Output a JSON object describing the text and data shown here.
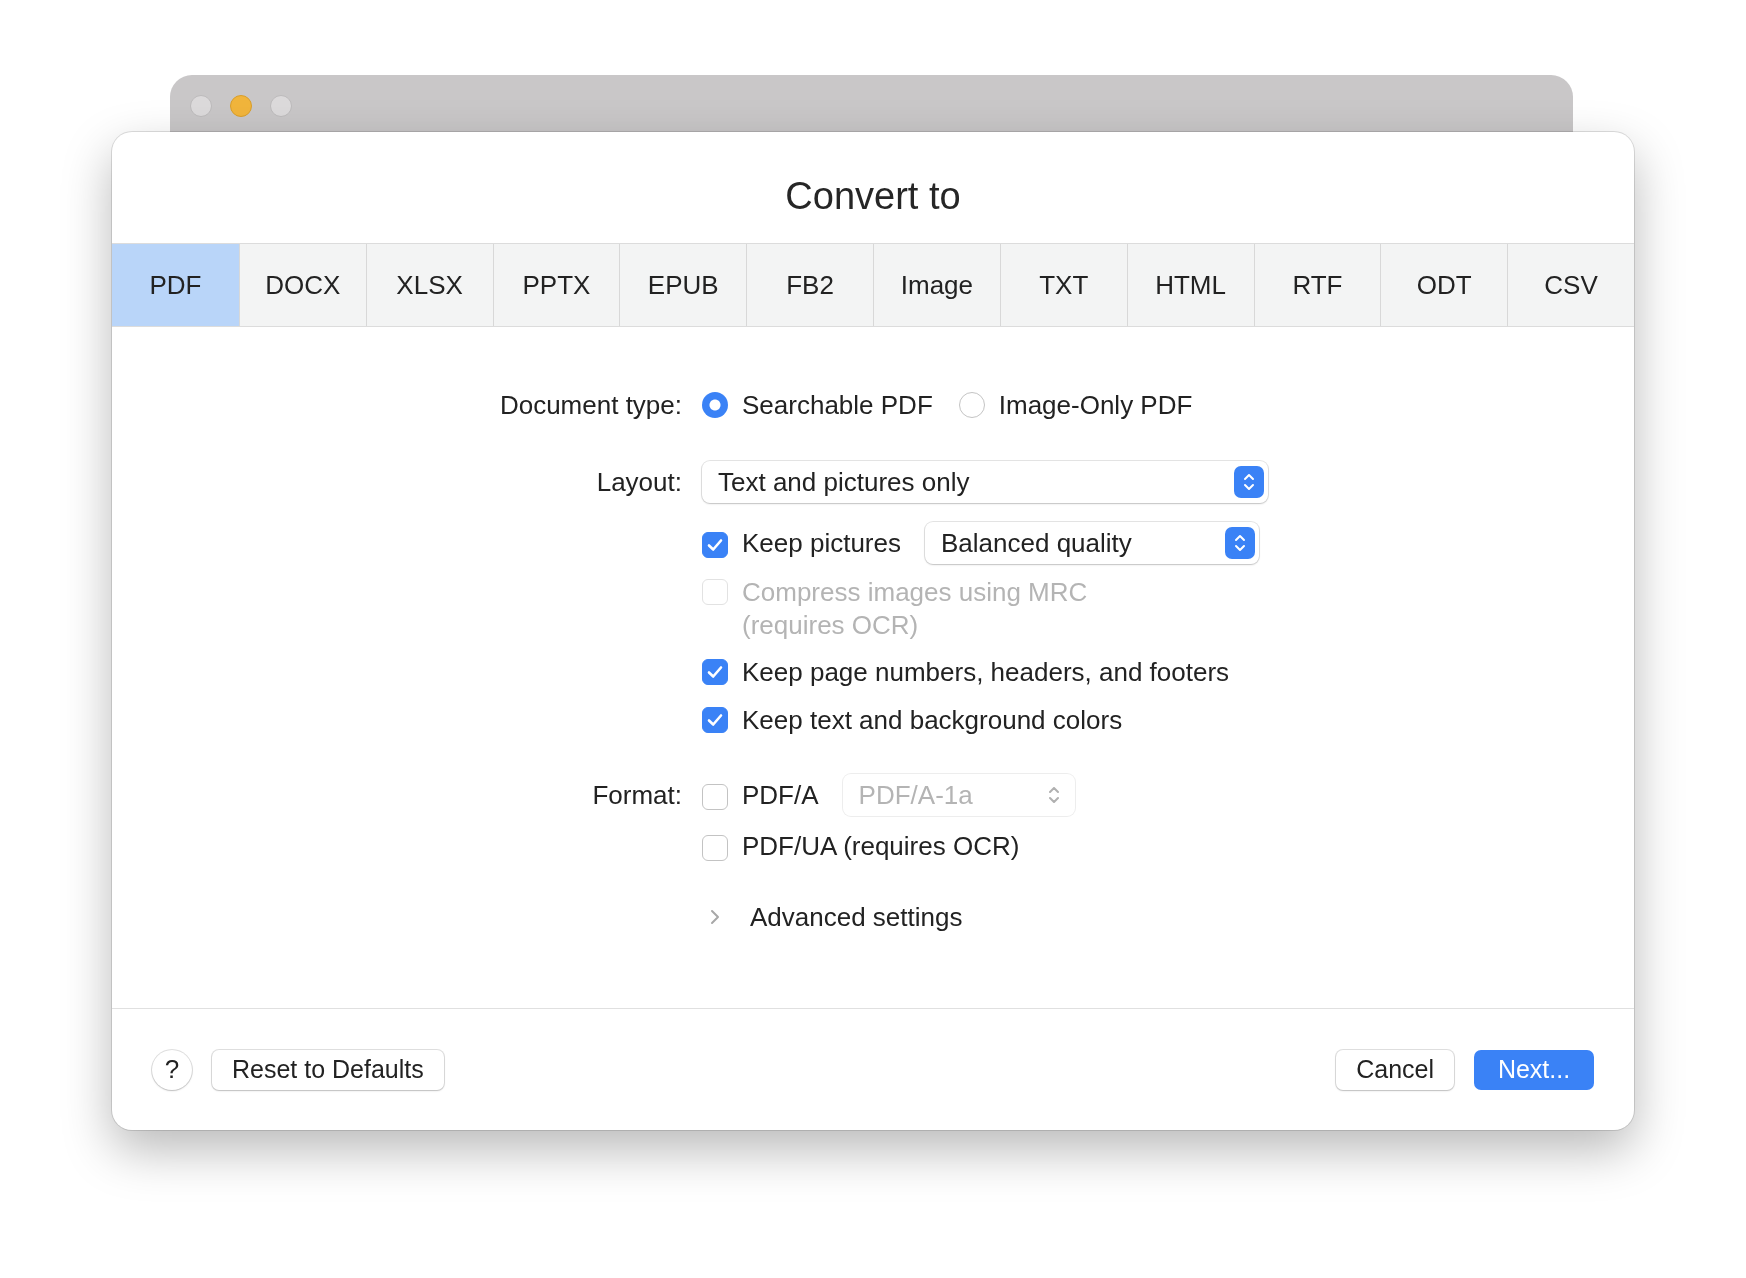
{
  "dialog": {
    "title": "Convert to"
  },
  "tabs": [
    {
      "label": "PDF",
      "selected": true
    },
    {
      "label": "DOCX",
      "selected": false
    },
    {
      "label": "XLSX",
      "selected": false
    },
    {
      "label": "PPTX",
      "selected": false
    },
    {
      "label": "EPUB",
      "selected": false
    },
    {
      "label": "FB2",
      "selected": false
    },
    {
      "label": "Image",
      "selected": false
    },
    {
      "label": "TXT",
      "selected": false
    },
    {
      "label": "HTML",
      "selected": false
    },
    {
      "label": "RTF",
      "selected": false
    },
    {
      "label": "ODT",
      "selected": false
    },
    {
      "label": "CSV",
      "selected": false
    }
  ],
  "document_type": {
    "label": "Document type:",
    "options": [
      {
        "label": "Searchable PDF",
        "selected": true
      },
      {
        "label": "Image-Only PDF",
        "selected": false
      }
    ]
  },
  "layout": {
    "label": "Layout:",
    "value": "Text and pictures only"
  },
  "options": [
    {
      "label": "Keep pictures",
      "checked": true,
      "disabled": false,
      "popup": "Balanced quality"
    },
    {
      "label": "Compress images using MRC (requires OCR)",
      "checked": false,
      "disabled": true
    },
    {
      "label": "Keep page numbers, headers, and footers",
      "checked": true,
      "disabled": false
    },
    {
      "label": "Keep text and background colors",
      "checked": true,
      "disabled": false
    }
  ],
  "format": {
    "label": "Format:",
    "items": [
      {
        "label": "PDF/A",
        "checked": false,
        "popup": {
          "value": "PDF/A-1a",
          "disabled": true
        }
      },
      {
        "label": "PDF/UA (requires OCR)",
        "checked": false
      }
    ]
  },
  "advanced": {
    "label": "Advanced settings",
    "expanded": false
  },
  "footer": {
    "help": "?",
    "reset": "Reset to Defaults",
    "cancel": "Cancel",
    "next": "Next..."
  }
}
